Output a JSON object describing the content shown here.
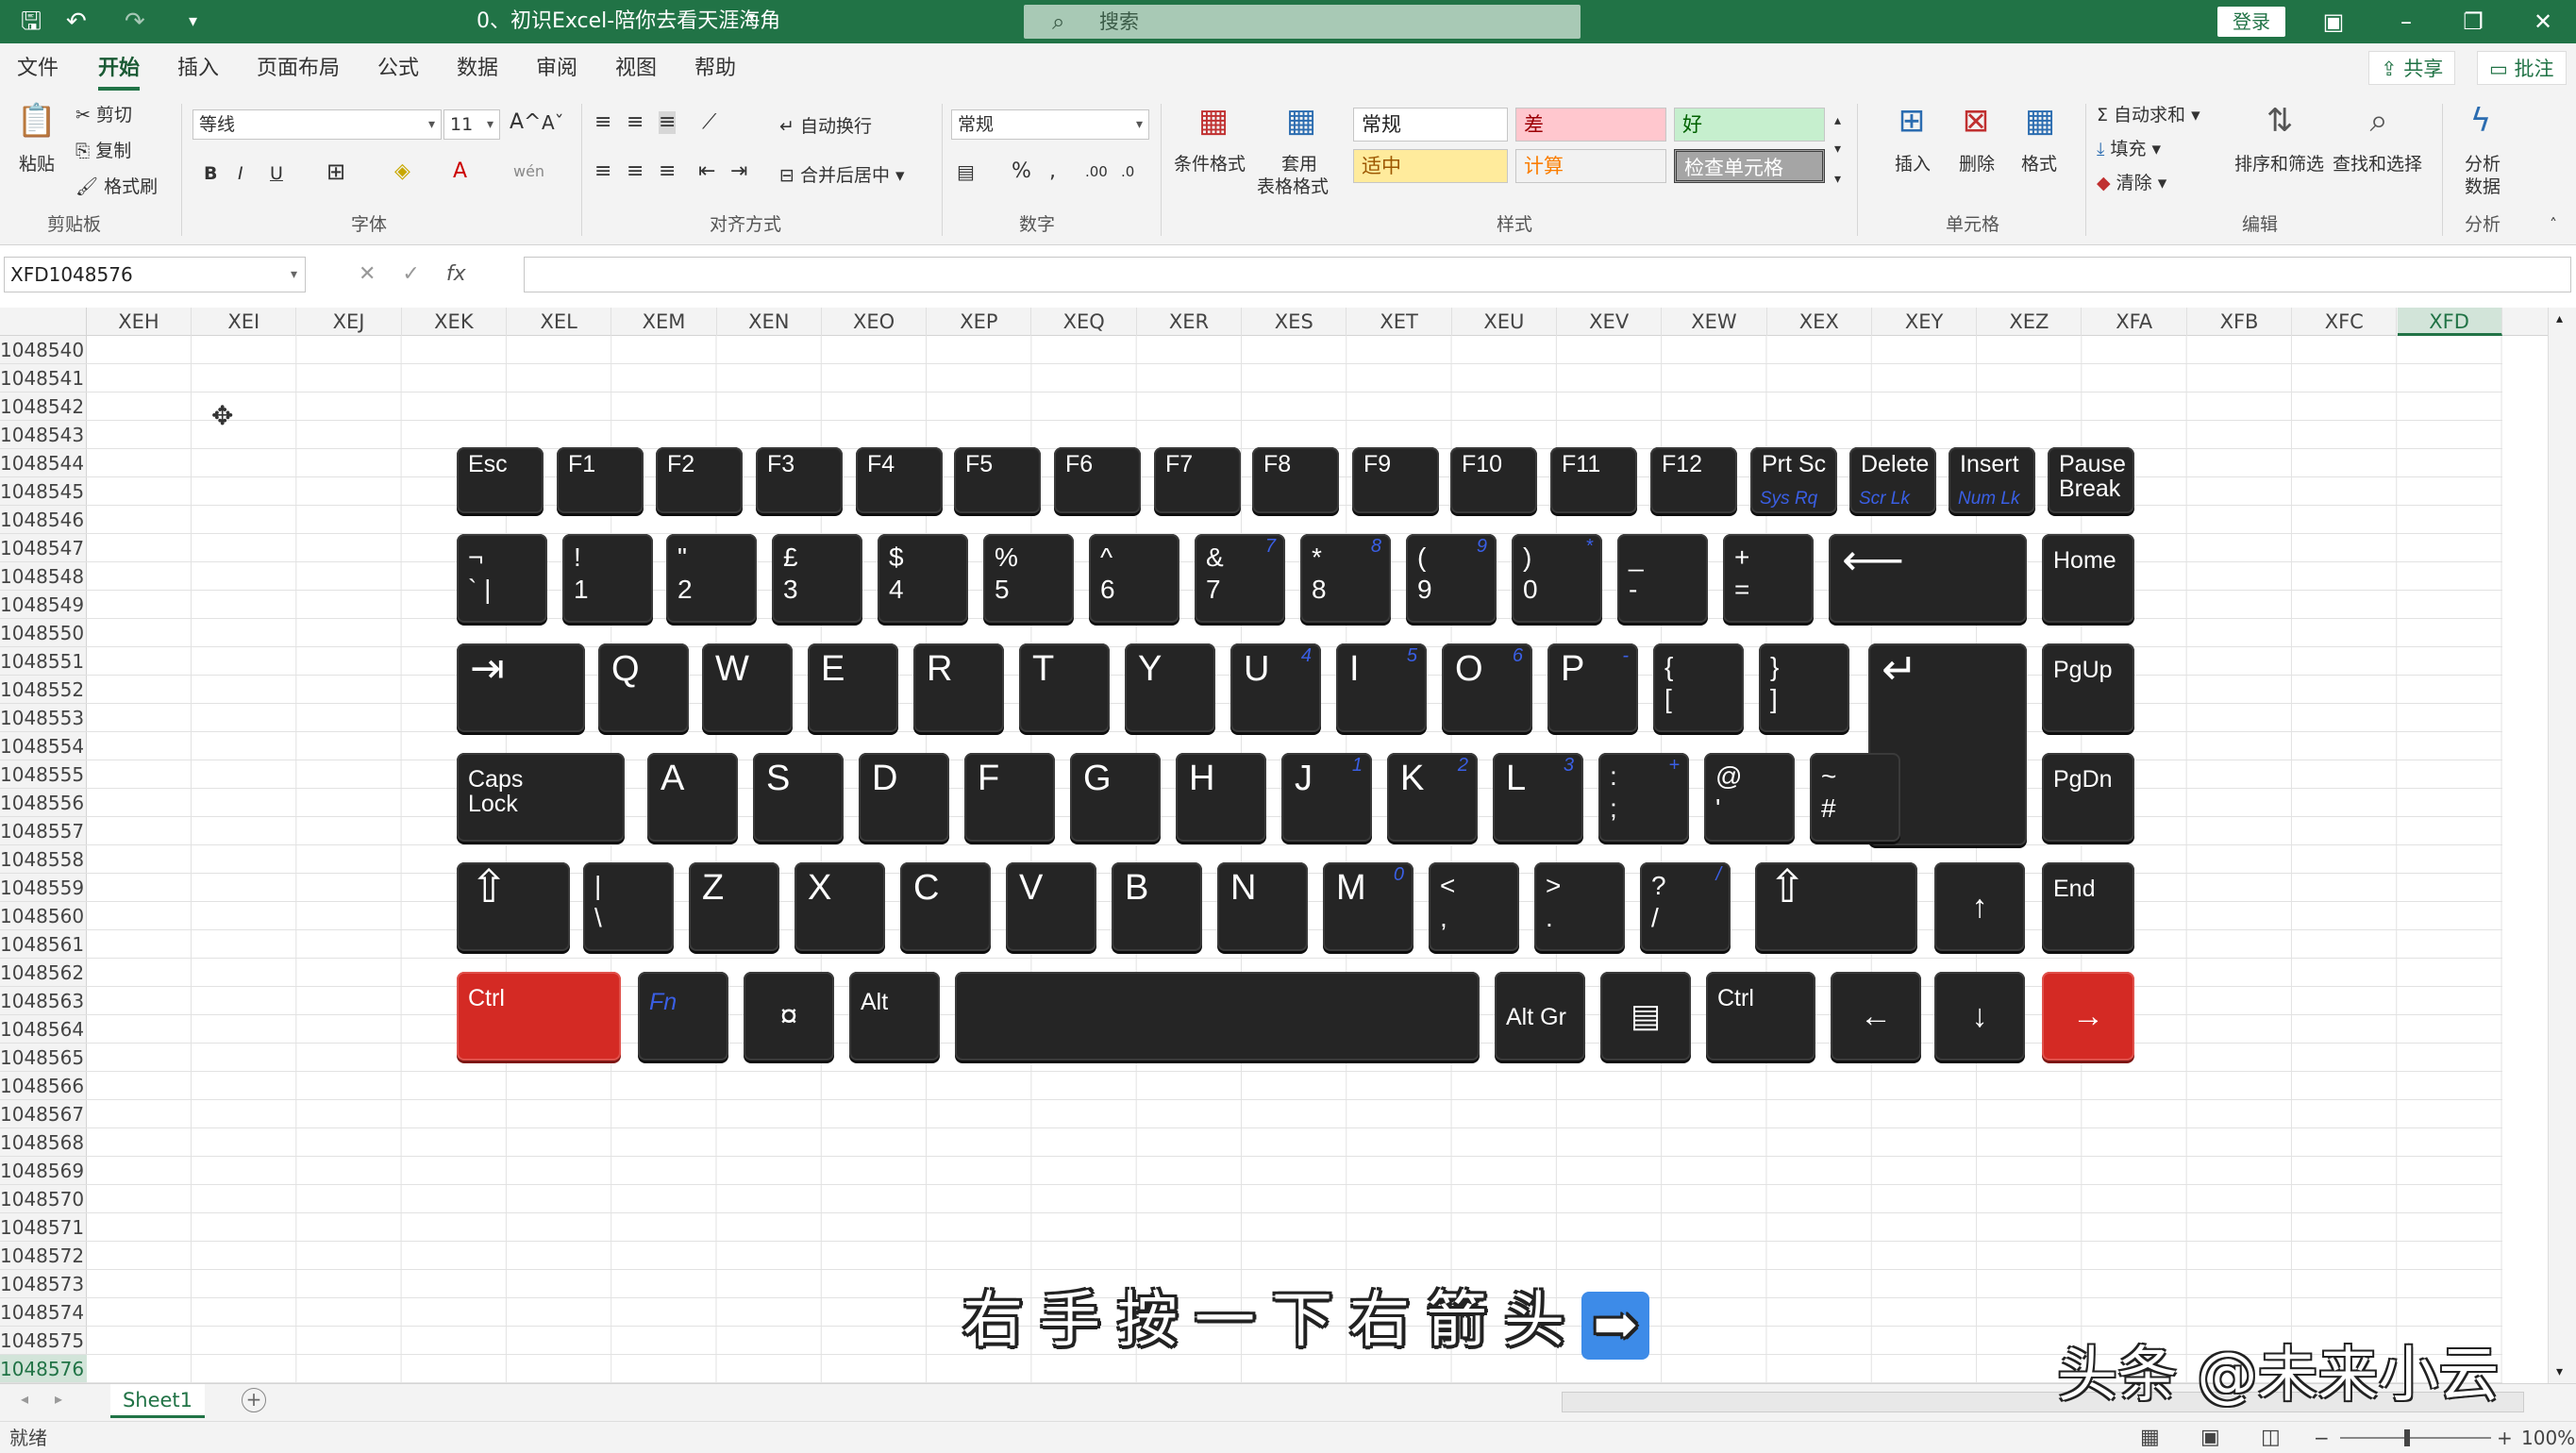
{
  "titlebar": {
    "doc_title": "0、初识Excel-陪你去看天涯海角",
    "search_placeholder": "搜索",
    "login": "登录"
  },
  "menu": {
    "tabs": [
      "文件",
      "开始",
      "插入",
      "页面布局",
      "公式",
      "数据",
      "审阅",
      "视图",
      "帮助"
    ],
    "active": "开始",
    "share": "共享",
    "comments": "批注"
  },
  "ribbon": {
    "clipboard": {
      "paste": "粘贴",
      "cut": "剪切",
      "copy": "复制",
      "format_painter": "格式刷",
      "label": "剪贴板"
    },
    "font": {
      "name": "等线",
      "size": "11",
      "label": "字体"
    },
    "alignment": {
      "wrap": "自动换行",
      "merge": "合并后居中",
      "label": "对齐方式"
    },
    "number": {
      "format": "常规",
      "label": "数字"
    },
    "styles": {
      "conditional": "条件格式",
      "table_format_1": "套用",
      "table_format_2": "表格格式",
      "normal": "常规",
      "bad": "差",
      "good": "好",
      "neutral": "适中",
      "calculation": "计算",
      "check_cell": "检查单元格",
      "label": "样式"
    },
    "cells": {
      "insert": "插入",
      "delete": "删除",
      "format": "格式",
      "label": "单元格"
    },
    "editing": {
      "autosum": "自动求和",
      "fill": "填充",
      "clear": "清除",
      "sort_filter": "排序和筛选",
      "find_select": "查找和选择",
      "label": "编辑"
    },
    "analysis": {
      "analyze_1": "分析",
      "analyze_2": "数据",
      "label": "分析"
    }
  },
  "formula_bar": {
    "name_box": "XFD1048576",
    "fx": "fx"
  },
  "columns": [
    "XEH",
    "XEI",
    "XEJ",
    "XEK",
    "XEL",
    "XEM",
    "XEN",
    "XEO",
    "XEP",
    "XEQ",
    "XER",
    "XES",
    "XET",
    "XEU",
    "XEV",
    "XEW",
    "XEX",
    "XEY",
    "XEZ",
    "XFA",
    "XFB",
    "XFC",
    "XFD"
  ],
  "selected_column": "XFD",
  "rows": [
    "1048540",
    "1048541",
    "1048542",
    "1048543",
    "1048544",
    "1048545",
    "1048546",
    "1048547",
    "1048548",
    "1048549",
    "1048550",
    "1048551",
    "1048552",
    "1048553",
    "1048554",
    "1048555",
    "1048556",
    "1048557",
    "1048558",
    "1048559",
    "1048560",
    "1048561",
    "1048562",
    "1048563",
    "1048564",
    "1048565",
    "1048566",
    "1048567",
    "1048568",
    "1048569",
    "1048570",
    "1048571",
    "1048572",
    "1048573",
    "1048574",
    "1048575",
    "1048576"
  ],
  "selected_row": "1048576",
  "keyboard": {
    "f_row": [
      "Esc",
      "F1",
      "F2",
      "F3",
      "F4",
      "F5",
      "F6",
      "F7",
      "F8",
      "F9",
      "F10",
      "F11",
      "F12"
    ],
    "prtsc": {
      "top": "Prt Sc",
      "sub": "Sys Rq"
    },
    "delete": {
      "top": "Delete",
      "sub": "Scr Lk"
    },
    "insert": {
      "top": "Insert",
      "sub": "Num Lk"
    },
    "pause": {
      "top": "Pause",
      "bottom": "Break"
    },
    "num_row": [
      {
        "t": "¬",
        "b": "` |"
      },
      {
        "t": "!",
        "b": "1"
      },
      {
        "t": "\"",
        "b": "2"
      },
      {
        "t": "£",
        "b": "3"
      },
      {
        "t": "$",
        "b": "4"
      },
      {
        "t": "%",
        "b": "5"
      },
      {
        "t": "^",
        "b": "6"
      },
      {
        "t": "&",
        "b": "7",
        "n": "7"
      },
      {
        "t": "*",
        "b": "8",
        "n": "8"
      },
      {
        "t": "(",
        "b": "9",
        "n": "9"
      },
      {
        "t": ")",
        "b": "0",
        "n": "*"
      },
      {
        "t": "_",
        "b": "-"
      },
      {
        "t": "+",
        "b": "="
      }
    ],
    "backspace": "⟵",
    "home": "Home",
    "q_row": [
      {
        "l": "Q"
      },
      {
        "l": "W"
      },
      {
        "l": "E"
      },
      {
        "l": "R"
      },
      {
        "l": "T"
      },
      {
        "l": "Y"
      },
      {
        "l": "U",
        "n": "4"
      },
      {
        "l": "I",
        "n": "5"
      },
      {
        "l": "O",
        "n": "6"
      },
      {
        "l": "P",
        "n": "-"
      }
    ],
    "q_row_brackets": [
      {
        "t": "{",
        "b": "["
      },
      {
        "t": "}",
        "b": "]"
      }
    ],
    "pgup": "PgUp",
    "caps": {
      "top": "Caps",
      "bottom": "Lock"
    },
    "a_row": [
      {
        "l": "A"
      },
      {
        "l": "S"
      },
      {
        "l": "D"
      },
      {
        "l": "F"
      },
      {
        "l": "G"
      },
      {
        "l": "H"
      },
      {
        "l": "J",
        "n": "1"
      },
      {
        "l": "K",
        "n": "2"
      },
      {
        "l": "L",
        "n": "3"
      }
    ],
    "a_row_symbols": [
      {
        "t": ":",
        "b": ";",
        "n": "+"
      },
      {
        "t": "@",
        "b": "'"
      },
      {
        "t": "~",
        "b": "#"
      }
    ],
    "pgdn": "PgDn",
    "z_row_pipe": {
      "t": "|",
      "b": "\\"
    },
    "z_row": [
      {
        "l": "Z"
      },
      {
        "l": "X"
      },
      {
        "l": "C"
      },
      {
        "l": "V"
      },
      {
        "l": "B"
      },
      {
        "l": "N"
      },
      {
        "l": "M",
        "n": "0"
      }
    ],
    "z_row_symbols": [
      {
        "t": "<",
        "b": ","
      },
      {
        "t": ">",
        "b": "."
      },
      {
        "t": "?",
        "b": "/",
        "n": "/"
      }
    ],
    "up": "↑",
    "end": "End",
    "ctrl_left": "Ctrl",
    "fn": "Fn",
    "win": "¤",
    "alt": "Alt",
    "altgr": "Alt Gr",
    "ctrl_right": "Ctrl",
    "left": "←",
    "down": "↓",
    "right": "→",
    "shift": "⇧",
    "tab": "⇥",
    "enter": "↵"
  },
  "sheets": {
    "active": "Sheet1",
    "add": "+"
  },
  "status": {
    "ready": "就绪",
    "zoom": "100%"
  },
  "caption": {
    "text": "右手按一下右箭头",
    "emoji": "➡"
  },
  "watermark": "头条 @未来小云",
  "colors": {
    "excel_green": "#217346",
    "key_dark": "#252525",
    "key_red": "#d42a24",
    "subscript_blue": "#3a5fe5"
  }
}
